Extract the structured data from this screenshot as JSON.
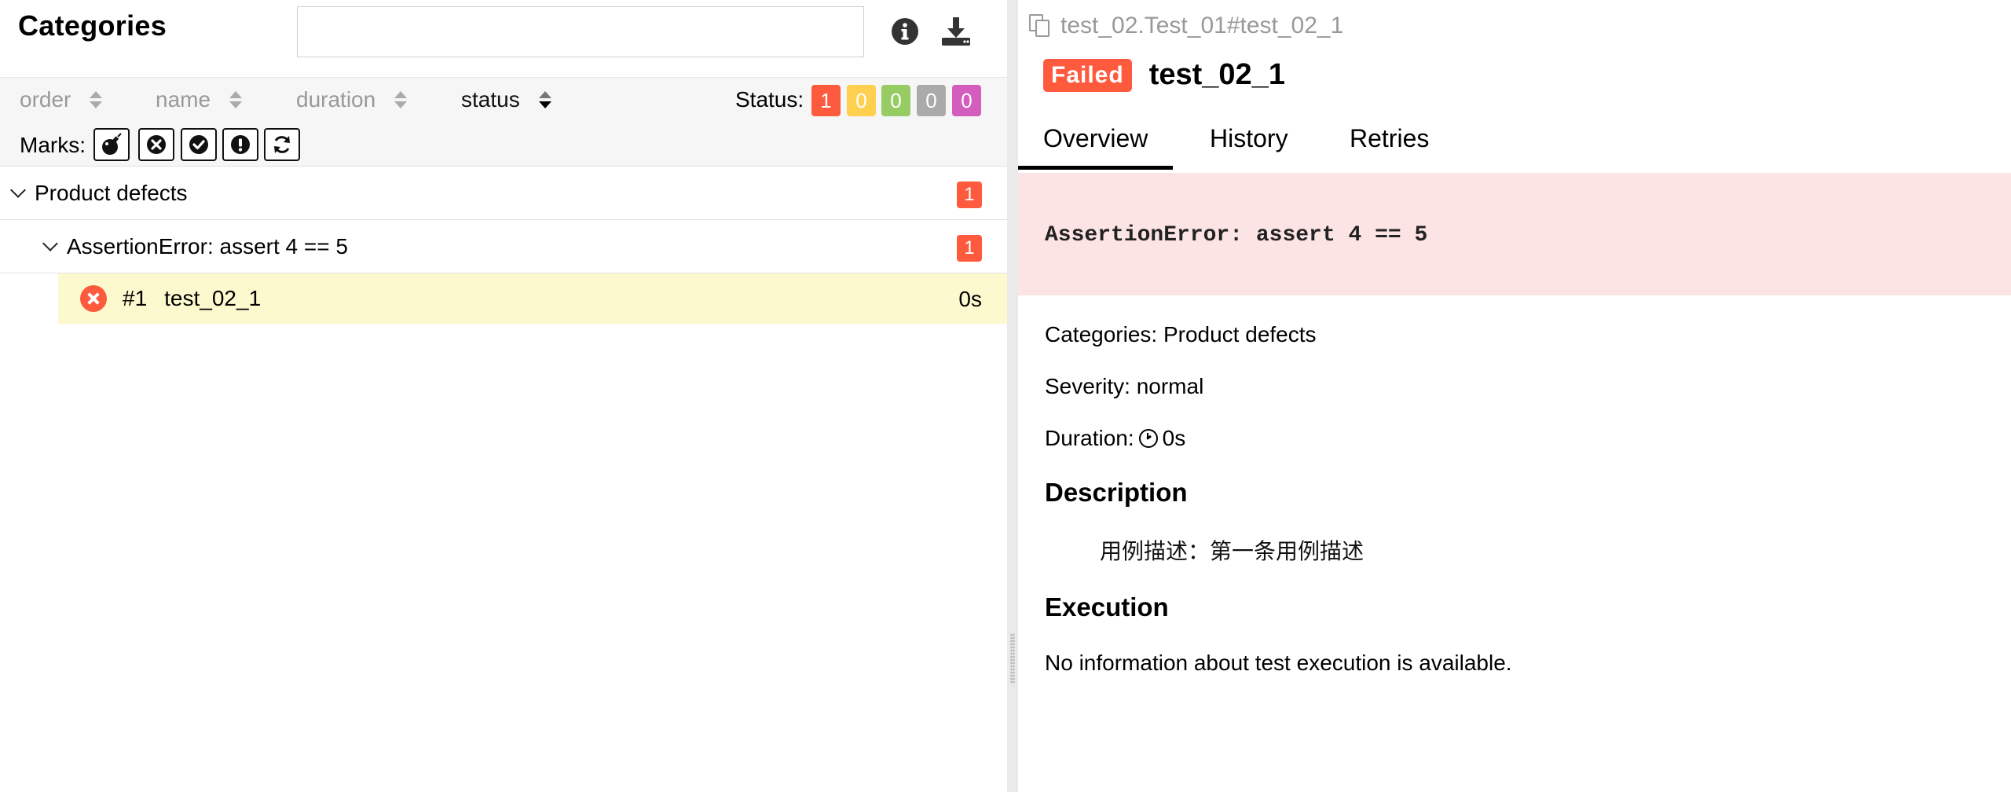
{
  "left": {
    "title": "Categories",
    "search": {
      "value": "",
      "placeholder": ""
    },
    "header_icons": [
      "info-icon",
      "download-icon"
    ],
    "sort_columns": [
      {
        "label": "order",
        "active": false
      },
      {
        "label": "name",
        "active": false
      },
      {
        "label": "duration",
        "active": false
      },
      {
        "label": "status",
        "active": true
      }
    ],
    "status_filter": {
      "label": "Status:",
      "badges": [
        {
          "value": "1",
          "color": "#fd5a3e"
        },
        {
          "value": "0",
          "color": "#ffd050"
        },
        {
          "value": "0",
          "color": "#97cc64"
        },
        {
          "value": "0",
          "color": "#aaaaaa"
        },
        {
          "value": "0",
          "color": "#d35ebe"
        }
      ]
    },
    "marks": {
      "label": "Marks:",
      "buttons": [
        "bomb-icon",
        "close-circle-icon",
        "check-circle-icon",
        "exclamation-circle-icon",
        "refresh-icon"
      ]
    },
    "tree": {
      "group": {
        "label": "Product defects",
        "count": "1"
      },
      "subgroup": {
        "label": "AssertionError: assert 4 == 5",
        "count": "1"
      },
      "test": {
        "number": "#1",
        "name": "test_02_1",
        "duration": "0s"
      }
    }
  },
  "right": {
    "path": "test_02.Test_01#test_02_1",
    "status_tag": "Failed",
    "title": "test_02_1",
    "tabs": [
      "Overview",
      "History",
      "Retries"
    ],
    "error_message": "AssertionError: assert 4 == 5",
    "categories": "Categories: Product defects",
    "severity": "Severity: normal",
    "duration_label": "Duration:",
    "duration_value": "0s",
    "description_heading": "Description",
    "description_text": "用例描述：第一条用例描述",
    "execution_heading": "Execution",
    "execution_text": "No information about test execution is available."
  },
  "colors": {
    "failed": "#fd5a3e",
    "error_bg": "#fde4e4",
    "selected_row": "#fdf9cf"
  }
}
